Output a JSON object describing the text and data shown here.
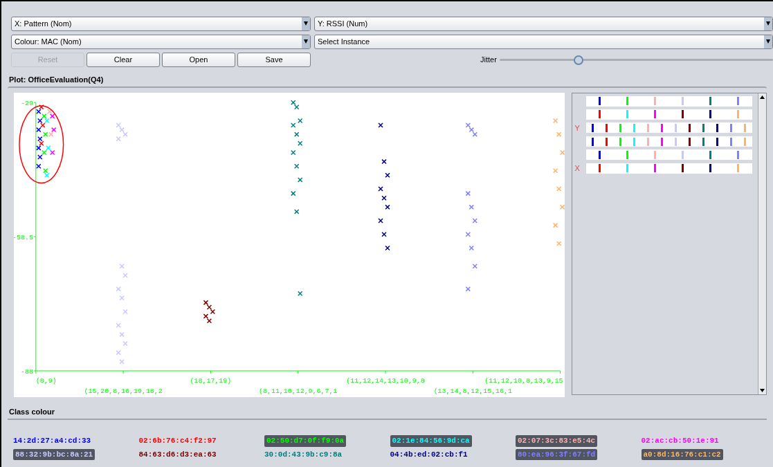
{
  "controls": {
    "x_axis": "X: Pattern (Nom)",
    "y_axis": "Y: RSSI (Num)",
    "colour": "Colour: MAC (Nom)",
    "instance": "Select Instance"
  },
  "buttons": [
    {
      "label": "Reset",
      "disabled": true
    },
    {
      "label": "Clear",
      "disabled": false
    },
    {
      "label": "Open",
      "disabled": false
    },
    {
      "label": "Save",
      "disabled": false
    }
  ],
  "jitter": {
    "label": "Jitter",
    "level": 0.29
  },
  "plot": {
    "title": "Plot: OfficeEvaluation(Q4)",
    "chart_data": {
      "type": "scatter",
      "ylim": [
        -88,
        -29
      ],
      "yticks": [
        -29,
        -58.5,
        -88
      ],
      "categories": [
        "(8,9)",
        "(15,20,8,16,19,18,2",
        "(18,17,19)",
        "(8,11,10,12,9,6,7,1",
        "(11,12,14,13,10,9,8",
        "(13,14,8,12,15,16,1",
        "(11,12,10,8,13,9,15"
      ],
      "series": [
        {
          "name": "14:2d:27:a4:cd:33",
          "color": "#0000ff",
          "x": [
            "(8,9)",
            "(8,9)",
            "(8,9)",
            "(8,9)",
            "(8,9)",
            "(8,9)",
            "(8,9)"
          ],
          "values": [
            -31,
            -33,
            -35,
            -37,
            -39,
            -41,
            -43
          ]
        },
        {
          "name": "02:6b:76:c4:f2:97",
          "color": "#ff0000",
          "x": [
            "(8,9)",
            "(8,9)",
            "(8,9)"
          ],
          "values": [
            -30,
            -34,
            -38
          ]
        },
        {
          "name": "02:50:d7:0f:f9:0a",
          "color": "#00ff00",
          "x": [
            "(8,9)",
            "(8,9)",
            "(8,9)",
            "(8,9)"
          ],
          "values": [
            -32,
            -36,
            -40,
            -44
          ]
        },
        {
          "name": "02:1e:84:56:9d:ca",
          "color": "#00ffff",
          "x": [
            "(8,9)",
            "(8,9)",
            "(8,9)"
          ],
          "values": [
            -33,
            -39,
            -45
          ]
        },
        {
          "name": "02:07:3c:83:e5:4c",
          "color": "#ffafaf",
          "x": [
            "(8,9)",
            "(8,9)"
          ],
          "values": [
            -31,
            -36
          ]
        },
        {
          "name": "02:ac:cb:50:1e:91",
          "color": "#ff00ff",
          "x": [
            "(8,9)",
            "(8,9)",
            "(8,9)"
          ],
          "values": [
            -32,
            -35,
            -40
          ]
        },
        {
          "name": "88:32:9b:bc:8a:21",
          "color": "#c8c8ff",
          "x": [
            "(15,20,8,16,19,18,2",
            "(15,20,8,16,19,18,2",
            "(15,20,8,16,19,18,2",
            "(15,20,8,16,19,18,2",
            "(15,20,8,16,19,18,2",
            "(15,20,8,16,19,18,2",
            "(15,20,8,16,19,18,2",
            "(15,20,8,16,19,18,2",
            "(15,20,8,16,19,18,2",
            "(15,20,8,16,19,18,2",
            "(15,20,8,16,19,18,2",
            "(15,20,8,16,19,18,2",
            "(15,20,8,16,19,18,2",
            "(15,20,8,16,19,18,2"
          ],
          "values": [
            -34,
            -35,
            -36,
            -37,
            -65,
            -67,
            -70,
            -72,
            -75,
            -78,
            -80,
            -82,
            -84,
            -86
          ]
        },
        {
          "name": "84:63:d6:d3:ea:63",
          "color": "#800000",
          "x": [
            "(18,17,19)",
            "(18,17,19)",
            "(18,17,19)",
            "(18,17,19)",
            "(18,17,19)"
          ],
          "values": [
            -73,
            -74,
            -75,
            -76,
            -77
          ]
        },
        {
          "name": "30:0d:43:9b:c9:8a",
          "color": "#008080",
          "x": [
            "(8,11,10,12,9,6,7,1",
            "(8,11,10,12,9,6,7,1",
            "(8,11,10,12,9,6,7,1",
            "(8,11,10,12,9,6,7,1",
            "(8,11,10,12,9,6,7,1",
            "(8,11,10,12,9,6,7,1",
            "(8,11,10,12,9,6,7,1",
            "(8,11,10,12,9,6,7,1",
            "(8,11,10,12,9,6,7,1",
            "(8,11,10,12,9,6,7,1",
            "(8,11,10,12,9,6,7,1",
            "(8,11,10,12,9,6,7,1"
          ],
          "values": [
            -29,
            -30,
            -33,
            -34,
            -36,
            -38,
            -40,
            -43,
            -46,
            -49,
            -53,
            -71
          ]
        },
        {
          "name": "04:4b:ed:02:cb:f1",
          "color": "#000080",
          "x": [
            "(11,12,14,13,10,9,8",
            "(11,12,14,13,10,9,8",
            "(11,12,14,13,10,9,8",
            "(11,12,14,13,10,9,8",
            "(11,12,14,13,10,9,8",
            "(11,12,14,13,10,9,8",
            "(11,12,14,13,10,9,8",
            "(11,12,14,13,10,9,8",
            "(11,12,14,13,10,9,8"
          ],
          "values": [
            -34,
            -42,
            -45,
            -48,
            -50,
            -52,
            -55,
            -58,
            -61
          ]
        },
        {
          "name": "80:ea:96:3f:67:fd",
          "color": "#8080ff",
          "x": [
            "(13,14,8,12,15,16,1",
            "(13,14,8,12,15,16,1",
            "(13,14,8,12,15,16,1",
            "(13,14,8,12,15,16,1",
            "(13,14,8,12,15,16,1",
            "(13,14,8,12,15,16,1",
            "(13,14,8,12,15,16,1",
            "(13,14,8,12,15,16,1",
            "(13,14,8,12,15,16,1",
            "(13,14,8,12,15,16,1"
          ],
          "values": [
            -34,
            -35,
            -36,
            -49,
            -52,
            -55,
            -58,
            -61,
            -65,
            -70
          ]
        },
        {
          "name": "a0:8d:16:76:c1:c2",
          "color": "#ffb366",
          "x": [
            "(11,12,10,8,13,9,15",
            "(11,12,10,8,13,9,15",
            "(11,12,10,8,13,9,15",
            "(11,12,10,8,13,9,15",
            "(11,12,10,8,13,9,15",
            "(11,12,10,8,13,9,15",
            "(11,12,10,8,13,9,15",
            "(11,12,10,8,13,9,15"
          ],
          "values": [
            -33,
            -36,
            -40,
            -44,
            -48,
            -52,
            -56,
            -60
          ]
        }
      ]
    }
  },
  "attribute_rows": [
    {},
    {},
    {
      "axis_label": "Y"
    },
    {},
    {},
    {
      "axis_label": "X"
    }
  ],
  "class_colour": {
    "title": "Class colour"
  }
}
